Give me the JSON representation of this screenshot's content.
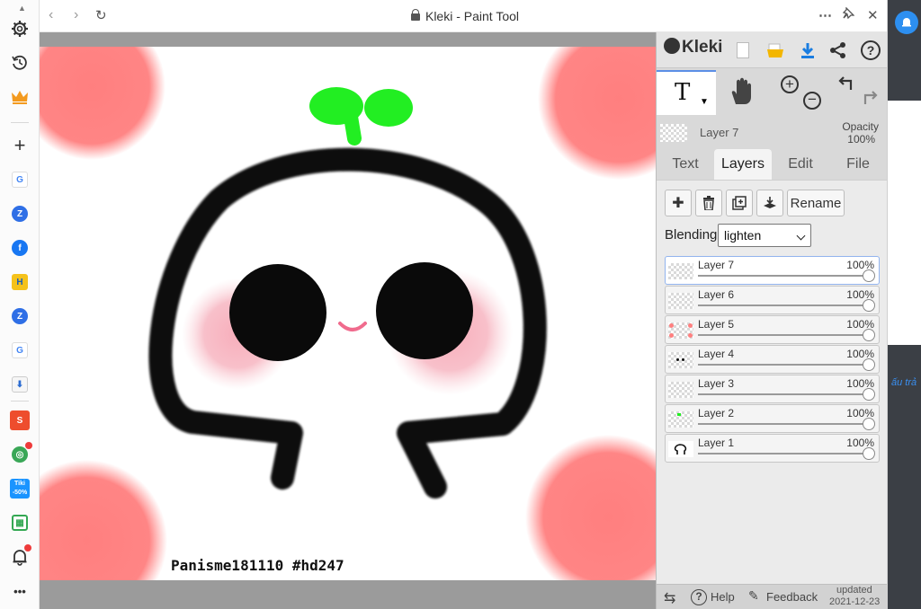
{
  "window": {
    "title": "Kleki - Paint Tool"
  },
  "left_rail": {
    "items": [
      "gear-icon",
      "history-icon",
      "crown-icon",
      "plus-icon",
      "google-icon",
      "zalo-icon",
      "facebook-icon",
      "h-app-icon",
      "zalo-icon",
      "google-icon",
      "download-app-icon",
      "shopee-icon",
      "chrome-like-icon",
      "tiki-icon",
      "sheets-icon",
      "bell-icon",
      "more-icon"
    ],
    "tiki_label": "Tiki",
    "tiki_discount": "-50%",
    "shopee_label": "Shopee",
    "more_label": "•••"
  },
  "canvas": {
    "signature": "Panisme181110 #hd247",
    "colors": {
      "outline": "#111111",
      "sprout": "#22ee22",
      "blush": "#f7b6c2",
      "dots": "#ff7f7f"
    }
  },
  "kleki": {
    "logo": "Kleki",
    "toolbar_icons": [
      "new-file-icon",
      "open-folder-icon",
      "download-icon",
      "share-icon",
      "help-icon"
    ],
    "tools": {
      "active_tool_label": "T",
      "undo_label": "undo",
      "redo_label": "redo"
    },
    "current_layer": {
      "name": "Layer 7",
      "opacity_label": "Opacity",
      "opacity_value": "100%"
    },
    "tabs": [
      {
        "label": "Text",
        "active": false
      },
      {
        "label": "Layers",
        "active": true
      },
      {
        "label": "Edit",
        "active": false
      },
      {
        "label": "File",
        "active": false
      }
    ],
    "layer_actions": {
      "add": "✚",
      "delete": "🗑",
      "duplicate": "⧉",
      "merge": "⤓",
      "rename": "Rename"
    },
    "blending_label": "Blending",
    "blending_value": "lighten",
    "layers": [
      {
        "name": "Layer 7",
        "opacity": "100%",
        "selected": true
      },
      {
        "name": "Layer 6",
        "opacity": "100%",
        "selected": false
      },
      {
        "name": "Layer 5",
        "opacity": "100%",
        "selected": false
      },
      {
        "name": "Layer 4",
        "opacity": "100%",
        "selected": false
      },
      {
        "name": "Layer 3",
        "opacity": "100%",
        "selected": false
      },
      {
        "name": "Layer 2",
        "opacity": "100%",
        "selected": false
      },
      {
        "name": "Layer 1",
        "opacity": "100%",
        "selected": false
      }
    ],
    "bottom": {
      "help": "Help",
      "feedback": "Feedback",
      "updated_label": "updated",
      "updated_date": "2021-12-23"
    }
  },
  "right_strip": {
    "partial_text": "ấu trả"
  }
}
